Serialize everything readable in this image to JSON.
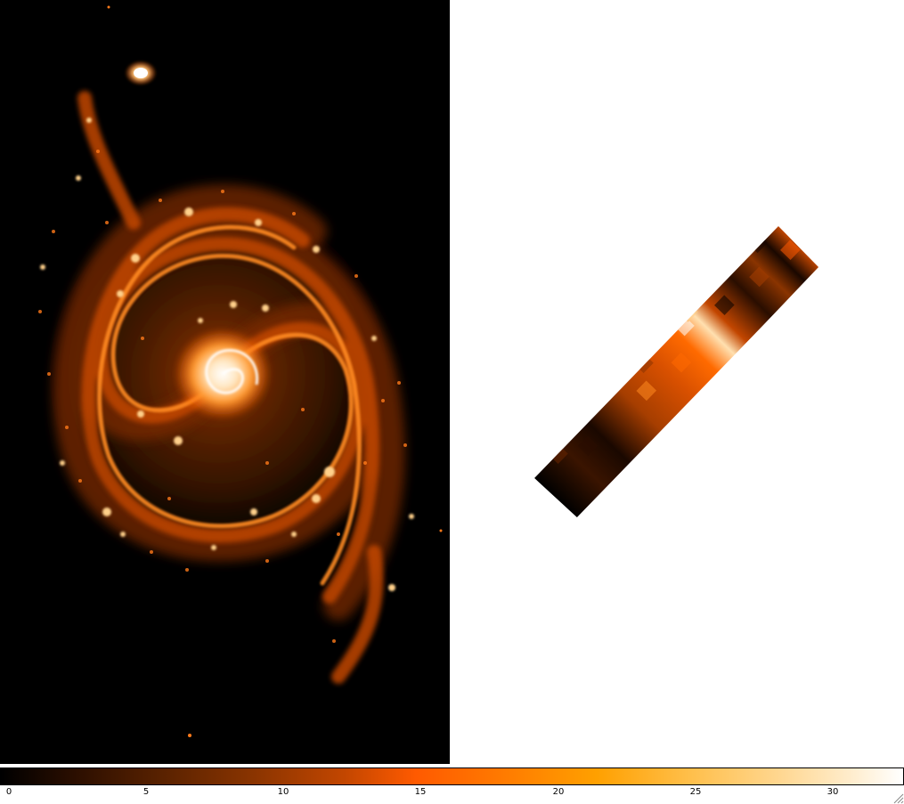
{
  "colorbar": {
    "ticks": [
      "0",
      "5",
      "10",
      "15",
      "20",
      "25",
      "30"
    ],
    "tick_values": [
      0,
      5,
      10,
      15,
      20,
      25,
      30
    ],
    "min": 0,
    "max": 32.8,
    "colormap_stops": [
      "#000000",
      "#5a2200",
      "#c24600",
      "#ff5a00",
      "#ffa000",
      "#ffd68e",
      "#ffffff"
    ]
  },
  "frames": {
    "left": {
      "content": "galaxy-image",
      "background": "#000000"
    },
    "right": {
      "content": "cutout-strip-image",
      "background": "#ffffff"
    }
  }
}
